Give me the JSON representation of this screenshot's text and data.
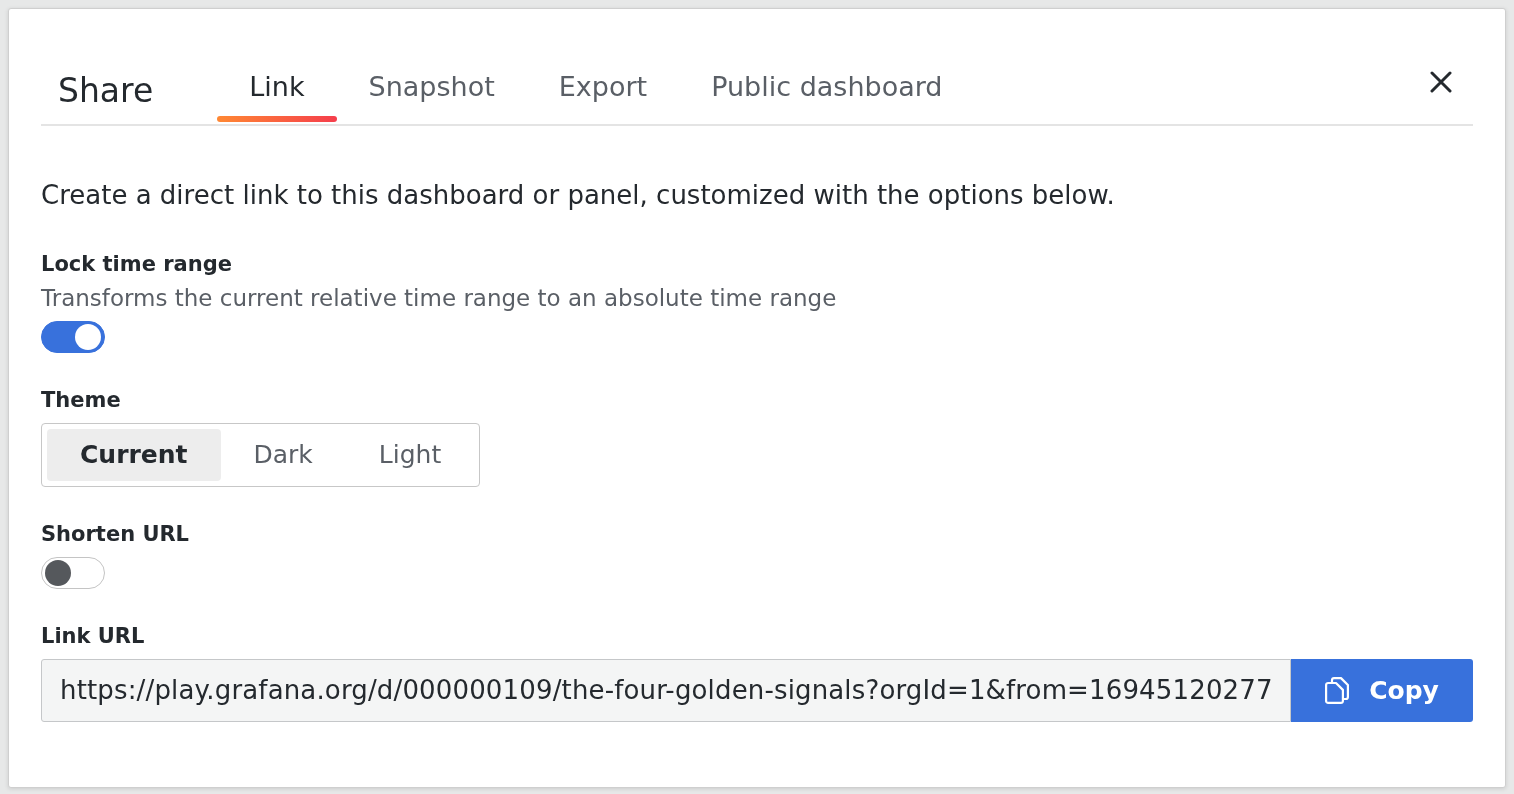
{
  "dialog": {
    "title": "Share"
  },
  "tabs": [
    {
      "label": "Link",
      "selected": true
    },
    {
      "label": "Snapshot",
      "selected": false
    },
    {
      "label": "Export",
      "selected": false
    },
    {
      "label": "Public dashboard",
      "selected": false
    }
  ],
  "intro": "Create a direct link to this dashboard or panel, customized with the options below.",
  "fields": [
    {
      "kind": "switch",
      "label": "Lock time range",
      "description": "Transforms the current relative time range to an absolute time range",
      "on": true
    },
    {
      "kind": "radio_group",
      "label": "Theme",
      "options": [
        {
          "label": "Current",
          "selected": true
        },
        {
          "label": "Dark",
          "selected": false
        },
        {
          "label": "Light",
          "selected": false
        }
      ]
    },
    {
      "kind": "switch",
      "label": "Shorten URL",
      "on": false
    },
    {
      "kind": "copy_url",
      "label": "Link URL",
      "value": "https://play.grafana.org/d/000000109/the-four-golden-signals?orgId=1&from=16945120277",
      "button": "Copy"
    }
  ]
}
